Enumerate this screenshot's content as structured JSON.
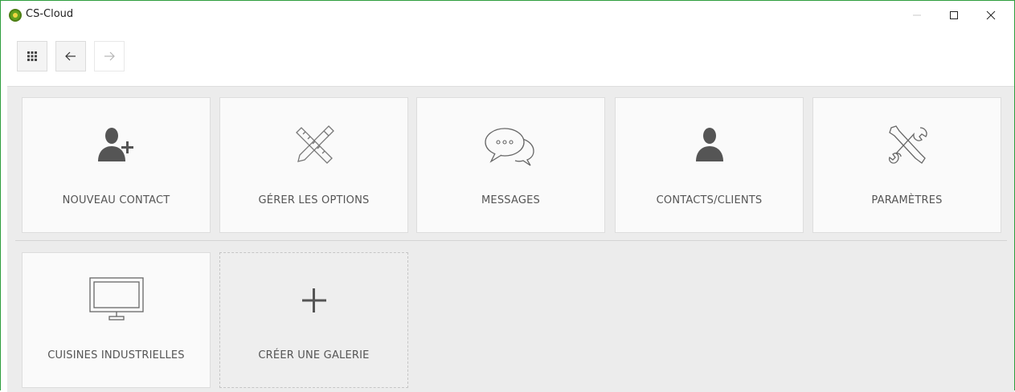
{
  "window": {
    "title": "CS-Cloud",
    "controls": [
      "minimize-icon",
      "maximize-icon",
      "close-icon"
    ],
    "accent_color": "#2e9e3e"
  },
  "toolbar": {
    "buttons": [
      {
        "icon": "apps-grid-icon",
        "enabled": true
      },
      {
        "icon": "arrow-left-icon",
        "enabled": true
      },
      {
        "icon": "arrow-right-icon",
        "enabled": false
      }
    ]
  },
  "tiles_row1": [
    {
      "label": "NOUVEAU CONTACT",
      "icon": "add-person-icon"
    },
    {
      "label": "GÉRER LES OPTIONS",
      "icon": "pencil-ruler-icon"
    },
    {
      "label": "MESSAGES",
      "icon": "chat-bubbles-icon"
    },
    {
      "label": "CONTACTS/CLIENTS",
      "icon": "person-icon"
    },
    {
      "label": "PARAMÈTRES",
      "icon": "tools-icon"
    }
  ],
  "tiles_row2": [
    {
      "label": "CUISINES INDUSTRIELLES",
      "icon": "monitor-icon"
    },
    {
      "label": "CRÉER UNE GALERIE",
      "icon": "plus-icon"
    }
  ]
}
